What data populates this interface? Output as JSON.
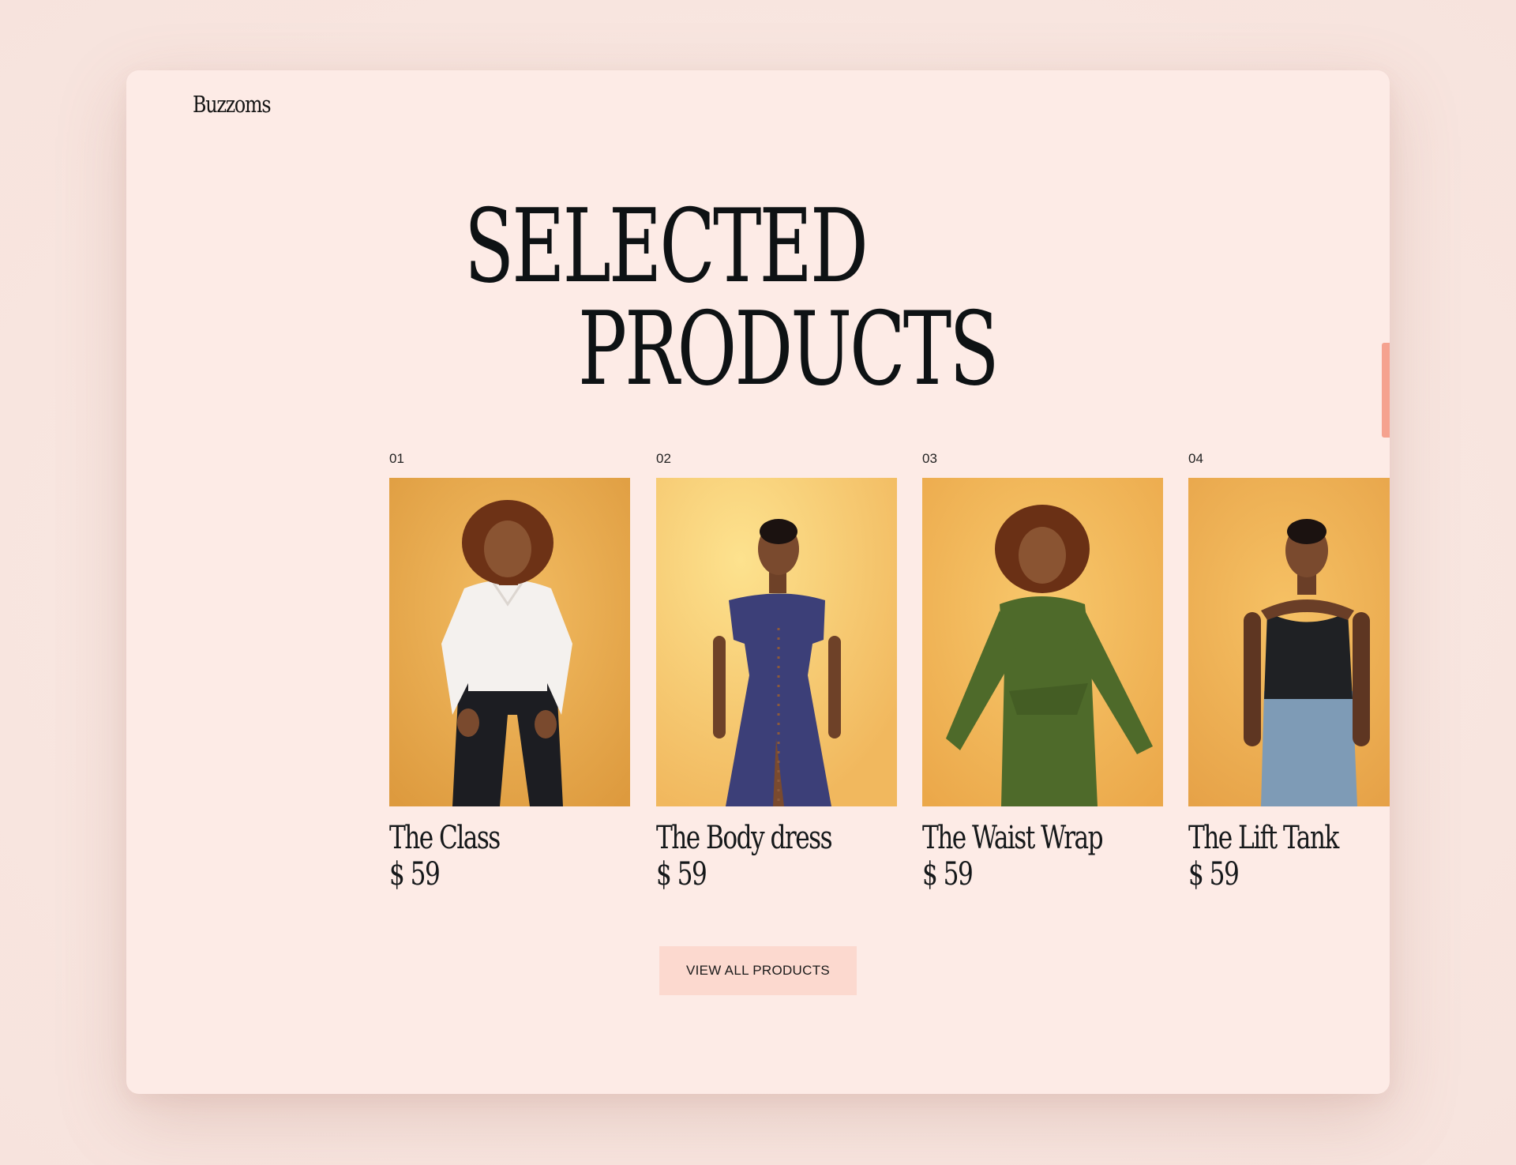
{
  "brand": {
    "logo": "Buzzoms"
  },
  "hero": {
    "line1": "SELECTED",
    "line2": "PRODUCTS"
  },
  "products": [
    {
      "number": "01",
      "name": "The Class",
      "price": "$ 59",
      "image": "woman-white-shirt-black-jeans"
    },
    {
      "number": "02",
      "name": "The Body dress",
      "price": "$ 59",
      "image": "woman-navy-button-dress"
    },
    {
      "number": "03",
      "name": "The Waist Wrap",
      "price": "$ 59",
      "image": "woman-green-wrap-dress"
    },
    {
      "number": "04",
      "name": "The Lift Tank",
      "price": "$ 59",
      "image": "woman-black-tank-blue-jeans"
    }
  ],
  "cta": {
    "label": "VIEW ALL PRODUCTS"
  },
  "colors": {
    "page_bg": "#f7e3dd",
    "card_bg": "#fdebe6",
    "accent": "#f5a28f",
    "button_bg": "#fcd9cf",
    "text": "#15181a",
    "photo_bg": "#f2b85c"
  }
}
